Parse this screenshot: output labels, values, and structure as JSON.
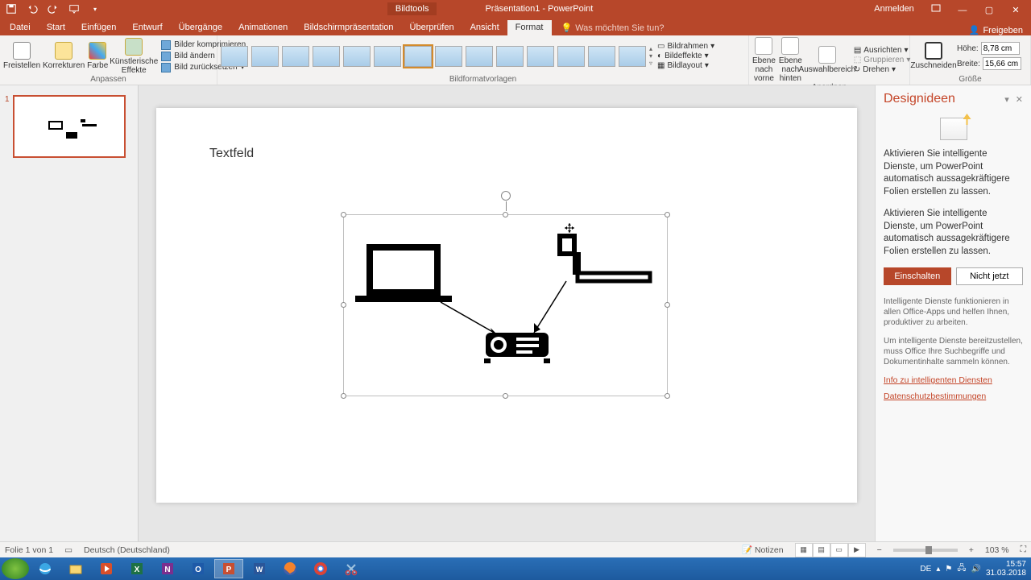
{
  "titlebar": {
    "context_tab": "Bildtools",
    "doc": "Präsentation1 - PowerPoint",
    "signin": "Anmelden"
  },
  "tabs": {
    "items": [
      "Datei",
      "Start",
      "Einfügen",
      "Entwurf",
      "Übergänge",
      "Animationen",
      "Bildschirmpräsentation",
      "Überprüfen",
      "Ansicht",
      "Format"
    ],
    "active_index": 9,
    "tell_me": "Was möchten Sie tun?",
    "share": "Freigeben"
  },
  "ribbon": {
    "anpassen": {
      "freistellen": "Freistellen",
      "korrekturen": "Korrekturen",
      "farbe": "Farbe",
      "effekte": "Künstlerische Effekte",
      "komprimieren": "Bilder komprimieren",
      "aendern": "Bild ändern",
      "zuruecksetzen": "Bild zurücksetzen",
      "label": "Anpassen"
    },
    "vorlagen_label": "Bildformatvorlagen",
    "bildrahmen": "Bildrahmen",
    "bildeffekte": "Bildeffekte",
    "bildlayout": "Bildlayout",
    "ebene_vorne": "Ebene nach vorne",
    "ebene_hinten": "Ebene nach hinten",
    "auswahl": "Auswahlbereich",
    "ausrichten": "Ausrichten",
    "gruppieren": "Gruppieren",
    "drehen": "Drehen",
    "anordnen_label": "Anordnen",
    "zuschneiden": "Zuschneiden",
    "hoehe_lbl": "Höhe:",
    "hoehe_val": "8,78 cm",
    "breite_lbl": "Breite:",
    "breite_val": "15,66 cm",
    "groesse_label": "Größe"
  },
  "slide": {
    "textfeld": "Textfeld"
  },
  "pane": {
    "title": "Designideen",
    "p1": "Aktivieren Sie intelligente Dienste, um PowerPoint automatisch aussagekräftigere Folien erstellen zu lassen.",
    "p2": "Aktivieren Sie intelligente Dienste, um PowerPoint automatisch aussagekräftigere Folien erstellen zu lassen.",
    "on": "Einschalten",
    "off": "Nicht jetzt",
    "s1": "Intelligente Dienste funktionieren in allen Office-Apps und helfen Ihnen, produktiver zu arbeiten.",
    "s2": "Um intelligente Dienste bereitzustellen, muss Office Ihre Suchbegriffe und Dokumentinhalte sammeln können.",
    "link1": "Info zu intelligenten Diensten",
    "link2": "Datenschutzbestimmungen"
  },
  "status": {
    "folie": "Folie 1 von 1",
    "lang": "Deutsch (Deutschland)",
    "notizen": "Notizen",
    "zoom": "103 %"
  },
  "tray": {
    "lang": "DE",
    "time": "15:57",
    "date": "31.03.2018"
  }
}
